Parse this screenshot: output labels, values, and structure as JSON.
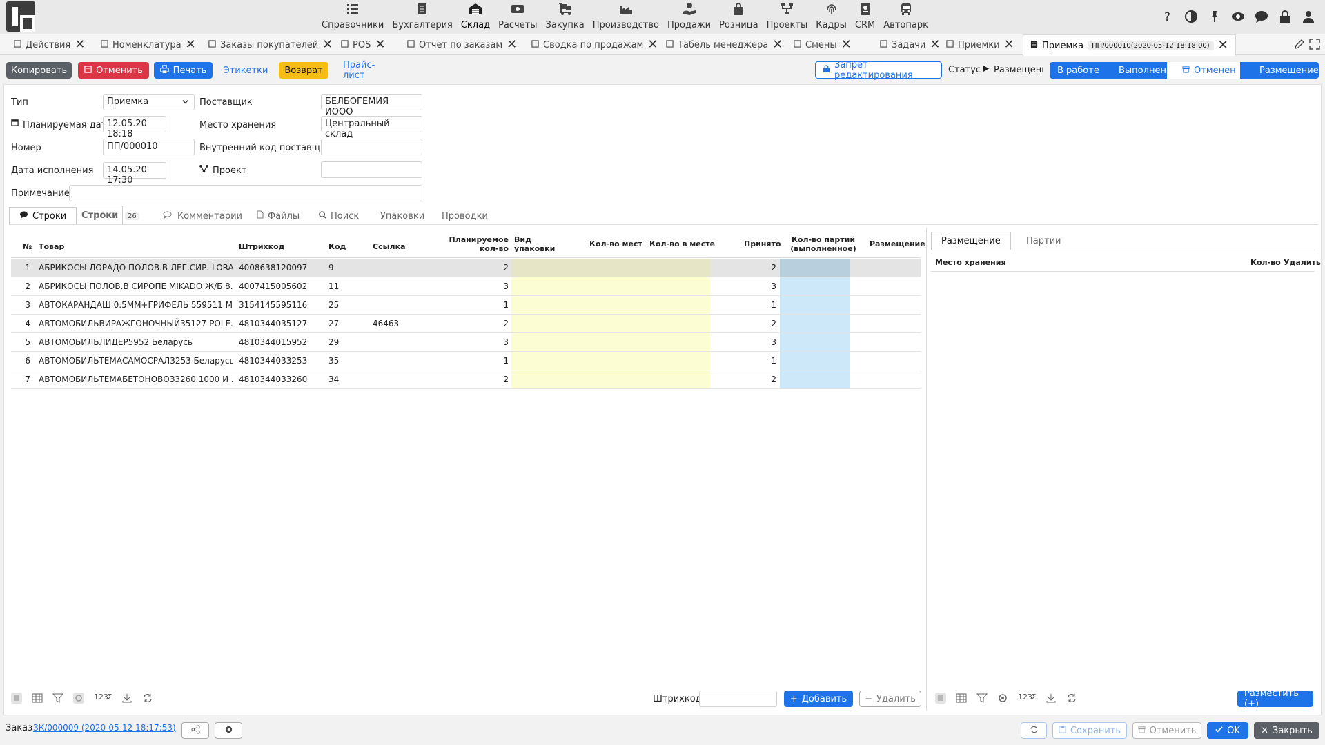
{
  "nav": {
    "items": [
      {
        "label": "Справочники",
        "icon": "list-check-icon"
      },
      {
        "label": "Бухгалтерия",
        "icon": "ledger-icon"
      },
      {
        "label": "Склад",
        "icon": "warehouse-icon",
        "active": true
      },
      {
        "label": "Расчеты",
        "icon": "money-icon"
      },
      {
        "label": "Закупка",
        "icon": "cart-dolly-icon"
      },
      {
        "label": "Производство",
        "icon": "factory-icon"
      },
      {
        "label": "Продажи",
        "icon": "hand-money-icon"
      },
      {
        "label": "Розница",
        "icon": "bag-icon"
      },
      {
        "label": "Проекты",
        "icon": "project-tree-icon"
      },
      {
        "label": "Кадры",
        "icon": "fingerprint-icon"
      },
      {
        "label": "CRM",
        "icon": "id-badge-icon"
      },
      {
        "label": "Автопарк",
        "icon": "bus-icon"
      }
    ],
    "right_icons": [
      "help-icon",
      "contrast-icon",
      "pin-icon",
      "eye-icon",
      "chat-icon",
      "lock-icon",
      "user-icon"
    ]
  },
  "doc_tabs": [
    {
      "label": "Действия"
    },
    {
      "label": "Номенклатура"
    },
    {
      "label": "Заказы покупателей"
    },
    {
      "label": "POS"
    },
    {
      "label": "Отчет по заказам"
    },
    {
      "label": "Сводка по продажам"
    },
    {
      "label": "Табель менеджера"
    },
    {
      "label": "Смены"
    },
    {
      "label": "Задачи"
    },
    {
      "label": "Приемки"
    }
  ],
  "active_tab": {
    "label": "Приемка",
    "code": "ПП/000010(2020-05-12 18:18:00)"
  },
  "actions": {
    "copy": "Копировать",
    "cancel": "Отменить",
    "print": "Печать",
    "labels": "Этикетки",
    "return": "Возврат",
    "pricelist": "Прайс-лист",
    "edit_lock": "Запрет редактирования",
    "status_label": "Статус",
    "status_value": "Размещени"
  },
  "steps": [
    "В работе",
    "Выполнен",
    "Отменен",
    "Размещение"
  ],
  "form": {
    "type_label": "Тип",
    "type_value": "Приемка",
    "supplier_label": "Поставщик",
    "supplier_value": "БЕЛБОГЕМИЯ ИООО",
    "planned_label": "Планируемая дата",
    "planned_value": "12.05.20 18:18",
    "storage_label": "Место хранения",
    "storage_value": "Центральный склад",
    "number_label": "Номер",
    "number_value": "ПП/000010",
    "internal_code_label": "Внутренний код поставщика",
    "internal_code_value": "",
    "exec_label": "Дата исполнения",
    "exec_value": "14.05.20 17:30",
    "project_label": "Проект",
    "project_value": "",
    "note_label": "Примечание",
    "note_value": ""
  },
  "subtabs": {
    "rows1": "Строки",
    "rows2": "Строки",
    "rows_count": "26",
    "comments": "Комментарии",
    "files": "Файлы",
    "search": "Поиск",
    "packages": "Упаковки",
    "postings": "Проводки"
  },
  "table": {
    "headers": {
      "num": "№",
      "item": "Товар",
      "barcode": "Штрихкод",
      "code": "Код",
      "link": "Ссылка",
      "planned1": "Планируемое",
      "planned2": "кол-во",
      "pack1": "Вид",
      "pack2": "упаковки",
      "places": "Кол-во мест",
      "inplace": "Кол-во в месте",
      "accepted": "Принято",
      "batches1": "Кол-во партий",
      "batches2": "(выполненное)",
      "placement": "Размещение"
    },
    "rows": [
      {
        "n": "1",
        "item": "АБРИКОСЫ ЛОРАДО ПОЛОВ.В ЛЕГ.СИР. LORA...",
        "barcode": "4008638120097",
        "code": "9",
        "link": "",
        "planned": "2",
        "accepted": "2"
      },
      {
        "n": "2",
        "item": "АБРИКОСЫ ПОЛОВ.В СИРОПЕ MIKADO Ж/Б 8...",
        "barcode": "4007415005602",
        "code": "11",
        "link": "",
        "planned": "3",
        "accepted": "3"
      },
      {
        "n": "3",
        "item": "АВТОКАРАНДАШ 0.5ММ+ГРИФЕЛЬ 559511 М...",
        "barcode": "3154145595116",
        "code": "25",
        "link": "",
        "planned": "1",
        "accepted": "1"
      },
      {
        "n": "4",
        "item": "АВТОМОБИЛЬВИРАЖГОНОЧНЫЙ35127 POLE...",
        "barcode": "4810344035127",
        "code": "27",
        "link": "46463",
        "planned": "2",
        "accepted": "2"
      },
      {
        "n": "5",
        "item": "АВТОМОБИЛЬЛИДЕР5952 Беларусь",
        "barcode": "4810344015952",
        "code": "29",
        "link": "",
        "planned": "3",
        "accepted": "3"
      },
      {
        "n": "6",
        "item": "АВТОМОБИЛЬТЕМАСАМОСРАЛ3253 Беларусь",
        "barcode": "4810344033253",
        "code": "35",
        "link": "",
        "planned": "1",
        "accepted": "1"
      },
      {
        "n": "7",
        "item": "АВТОМОБИЛЬТЕМАБЕТОНОВОЗ3260 1000 И ...",
        "barcode": "4810344033260",
        "code": "34",
        "link": "",
        "planned": "2",
        "accepted": "2"
      }
    ]
  },
  "bottom_left": {
    "barcode_label": "Штрихкод",
    "add": "Добавить",
    "delete": "Удалить",
    "numfmt": "123"
  },
  "right_panel": {
    "tab_placement": "Размещение",
    "tab_batches": "Партии",
    "col_storage": "Место хранения",
    "col_qty": "Кол-во",
    "col_delete": "Удалить",
    "place_button": "Разместить (+)",
    "numfmt": "123"
  },
  "footer": {
    "order_label": "Заказ",
    "order_link": "ЗК/000009 (2020-05-12 18:17:53)",
    "save": "Сохранить",
    "cancel": "Отменить",
    "ok": "OK",
    "close": "Закрыть"
  }
}
